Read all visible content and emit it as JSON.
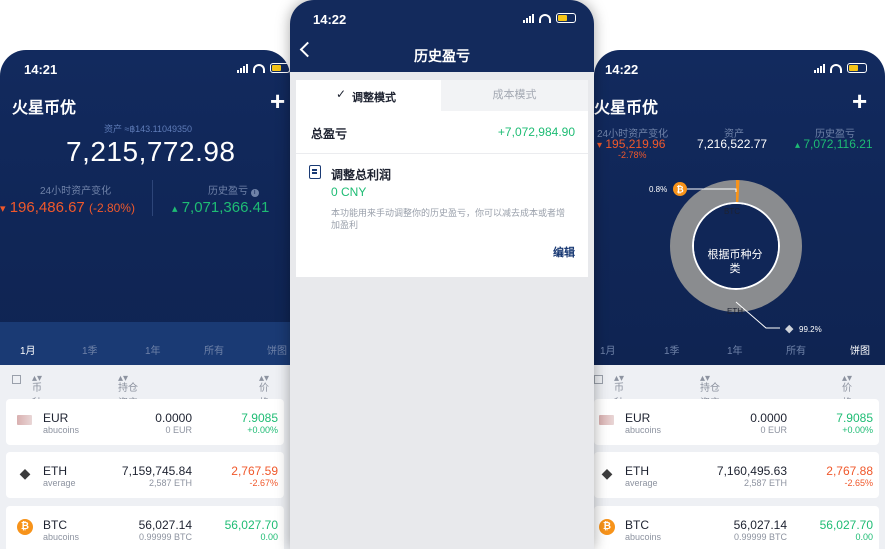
{
  "left": {
    "status_time": "14:21",
    "title": "火星币优",
    "plus": "+",
    "assets_label": "资产 ≈฿143.11049350",
    "assets_value": "7,215,772.98",
    "change_label": "24小时资产变化",
    "change_arrow": "▾",
    "change_value": "196,486.67",
    "change_pct": "(-2.80%)",
    "history_label": "历史盈亏",
    "history_info": "i",
    "history_arrow": "▴",
    "history_value": "7,071,366.41",
    "tabs": [
      "1月",
      "1季",
      "1年",
      "所有",
      "饼图"
    ],
    "head": {
      "coin": "币种",
      "holding": "持仓资产(CNY)",
      "price": "价格"
    },
    "rows": [
      {
        "name": "EUR",
        "sub": "abucoins",
        "hold": "0.0000",
        "hold_sub": "0 EUR",
        "price": "7.9085",
        "pct": "+0.00%",
        "icon": "eur-flag-icon",
        "color": "green"
      },
      {
        "name": "ETH",
        "sub": "average",
        "hold": "7,159,745.84",
        "hold_sub": "2,587 ETH",
        "price": "2,767.59",
        "pct": "-2.67%",
        "icon": "eth-icon",
        "color": "red"
      },
      {
        "name": "BTC",
        "sub": "abucoins",
        "hold": "56,027.14",
        "hold_sub": "0.99999 BTC",
        "price": "56,027.70",
        "pct": "0.00",
        "icon": "btc-icon",
        "color": "green"
      }
    ]
  },
  "mid": {
    "status_time": "14:22",
    "title": "历史盈亏",
    "tab_active": "调整模式",
    "tab_inactive": "成本模式",
    "total_label": "总盈亏",
    "total_value": "+7,072,984.90",
    "adjust_title": "调整总利润",
    "adjust_value": "0 CNY",
    "adjust_desc": "本功能用来手动调整你的历史盈亏，你可以减去成本或者增加盈利",
    "edit_label": "编辑"
  },
  "right": {
    "status_time": "14:22",
    "title": "火星币优",
    "plus": "+",
    "change_label": "24小时资产变化",
    "change_arrow": "▾",
    "change_value": "195,219.96",
    "change_pct": "-2.78%",
    "assets_label": "资产",
    "assets_value": "7,216,522.77",
    "history_label": "历史盈亏",
    "history_arrow": "▴",
    "history_value": "7,072,116.21",
    "donut_center": "根据币种分类",
    "btc_pct": "0.8%",
    "btc_label": "BTC",
    "eth_label": "ETH",
    "eth_pct": "99.2%",
    "tabs": [
      "1月",
      "1季",
      "1年",
      "所有",
      "饼图"
    ],
    "head": {
      "coin": "币种",
      "holding": "持仓资产(CNY)",
      "price": "价格"
    },
    "rows": [
      {
        "name": "EUR",
        "sub": "abucoins",
        "hold": "0.0000",
        "hold_sub": "0 EUR",
        "price": "7.9085",
        "pct": "+0.00%",
        "icon": "eur-flag-icon",
        "color": "green"
      },
      {
        "name": "ETH",
        "sub": "average",
        "hold": "7,160,495.63",
        "hold_sub": "2,587 ETH",
        "price": "2,767.88",
        "pct": "-2.65%",
        "icon": "eth-icon",
        "color": "red"
      },
      {
        "name": "BTC",
        "sub": "abucoins",
        "hold": "56,027.14",
        "hold_sub": "0.99999 BTC",
        "price": "56,027.70",
        "pct": "0.00",
        "icon": "btc-icon",
        "color": "green"
      }
    ]
  },
  "colors": {
    "navy": "#102657",
    "green": "#1ebc74",
    "red": "#f0582b",
    "btc": "#f7931a",
    "donut": "#8a8c8f"
  }
}
